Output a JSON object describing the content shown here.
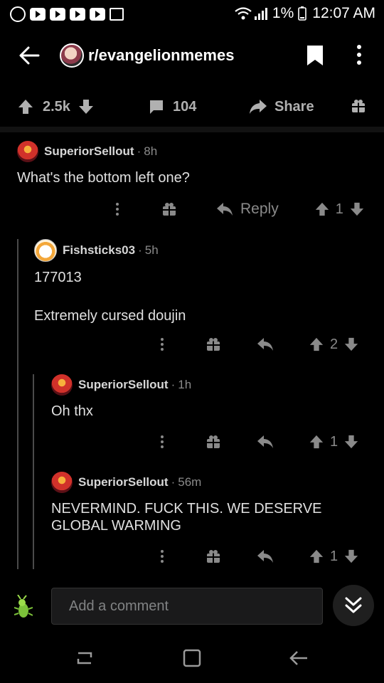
{
  "status": {
    "battery": "1%",
    "time": "12:07 AM",
    "icons": [
      "whatsapp-icon",
      "youtube-icon",
      "youtube-icon",
      "youtube-icon",
      "youtube-icon",
      "gallery-icon",
      "wifi-icon",
      "signal-icon",
      "battery-icon"
    ]
  },
  "header": {
    "subreddit": "r/evangelionmemes",
    "icons": [
      "back-arrow-icon",
      "subreddit-avatar",
      "bookmark-icon",
      "more-vertical-icon"
    ]
  },
  "post": {
    "score": "2.5k",
    "comments": "104",
    "share_label": "Share"
  },
  "comments": [
    {
      "author": "SuperiorSellout",
      "time": "8h",
      "body": "What's the bottom left one?",
      "reply_label": "Reply",
      "score": "1"
    },
    {
      "author": "Fishsticks03",
      "time": "5h",
      "body_line1": "177013",
      "body_line2": "Extremely cursed doujin",
      "score": "2"
    },
    {
      "author": "SuperiorSellout",
      "time": "1h",
      "body": "Oh thx",
      "score": "1"
    },
    {
      "author": "SuperiorSellout",
      "time": "56m",
      "body": "NEVERMIND. FUCK THIS. WE DESERVE GLOBAL WARMING",
      "score": "1"
    }
  ],
  "composer": {
    "placeholder": "Add a comment"
  },
  "colors": {
    "background": "#000000",
    "text": "#d7d7d7",
    "muted": "#8a8a8a",
    "input": "#1a1a1b"
  }
}
